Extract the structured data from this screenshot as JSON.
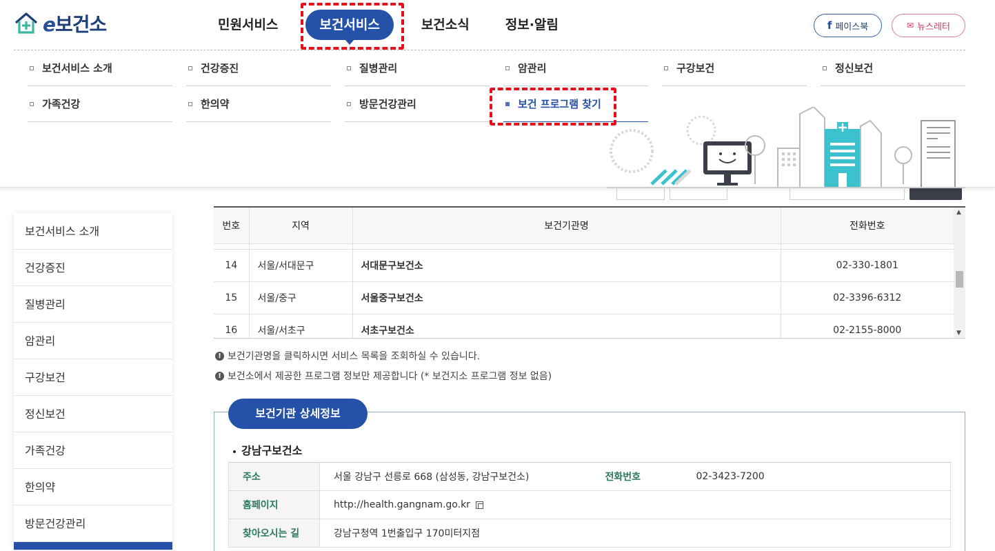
{
  "header": {
    "logo": {
      "prefix": "e",
      "text": "보건소"
    },
    "gnb": [
      "민원서비스",
      "보건서비스",
      "보건소식",
      "정보·알림"
    ],
    "facebook_label": "페이스북",
    "newsletter_label": "뉴스레터"
  },
  "mega_menu": {
    "items": [
      "보건서비스 소개",
      "건강증진",
      "질병관리",
      "암관리",
      "구강보건",
      "정신보건",
      "가족건강",
      "한의약",
      "방문건강관리",
      "보건 프로그램 찾기"
    ],
    "active": "보건 프로그램 찾기"
  },
  "side_menu": {
    "items": [
      "보건서비스 소개",
      "건강증진",
      "질병관리",
      "암관리",
      "구강보건",
      "정신보건",
      "가족건강",
      "한의약",
      "방문건강관리"
    ]
  },
  "table": {
    "headers": [
      "번호",
      "지역",
      "보건기관명",
      "전화번호"
    ],
    "rows": [
      {
        "no": "14",
        "region": "서울/서대문구",
        "name": "서대문구보건소",
        "tel": "02-330-1801"
      },
      {
        "no": "15",
        "region": "서울/중구",
        "name": "서울중구보건소",
        "tel": "02-3396-6312"
      },
      {
        "no": "16",
        "region": "서울/서초구",
        "name": "서초구보건소",
        "tel": "02-2155-8000"
      }
    ]
  },
  "notices": [
    "보건기관명을 클릭하시면 서비스 목록을 조회하실 수 있습니다.",
    "보건소에서 제공한 프로그램 정보만 제공합니다 (* 보건지소 프로그램 정보 없음)"
  ],
  "detail": {
    "tab_label": "보건기관 상세정보",
    "org_name": "강남구보건소",
    "address_label": "주소",
    "address": "서울 강남구 선릉로 668 (삼성동, 강남구보건소)",
    "tel_label": "전화번호",
    "tel": "02-3423-7200",
    "homepage_label": "홈페이지",
    "homepage": "http://health.gangnam.go.kr",
    "directions_label": "찾아오시는 길",
    "directions": "강남구청역 1번출입구 170미터지점"
  },
  "colors": {
    "brand": "#2552a8",
    "highlight": "#e4101a",
    "label_green": "#2a7a5a"
  }
}
